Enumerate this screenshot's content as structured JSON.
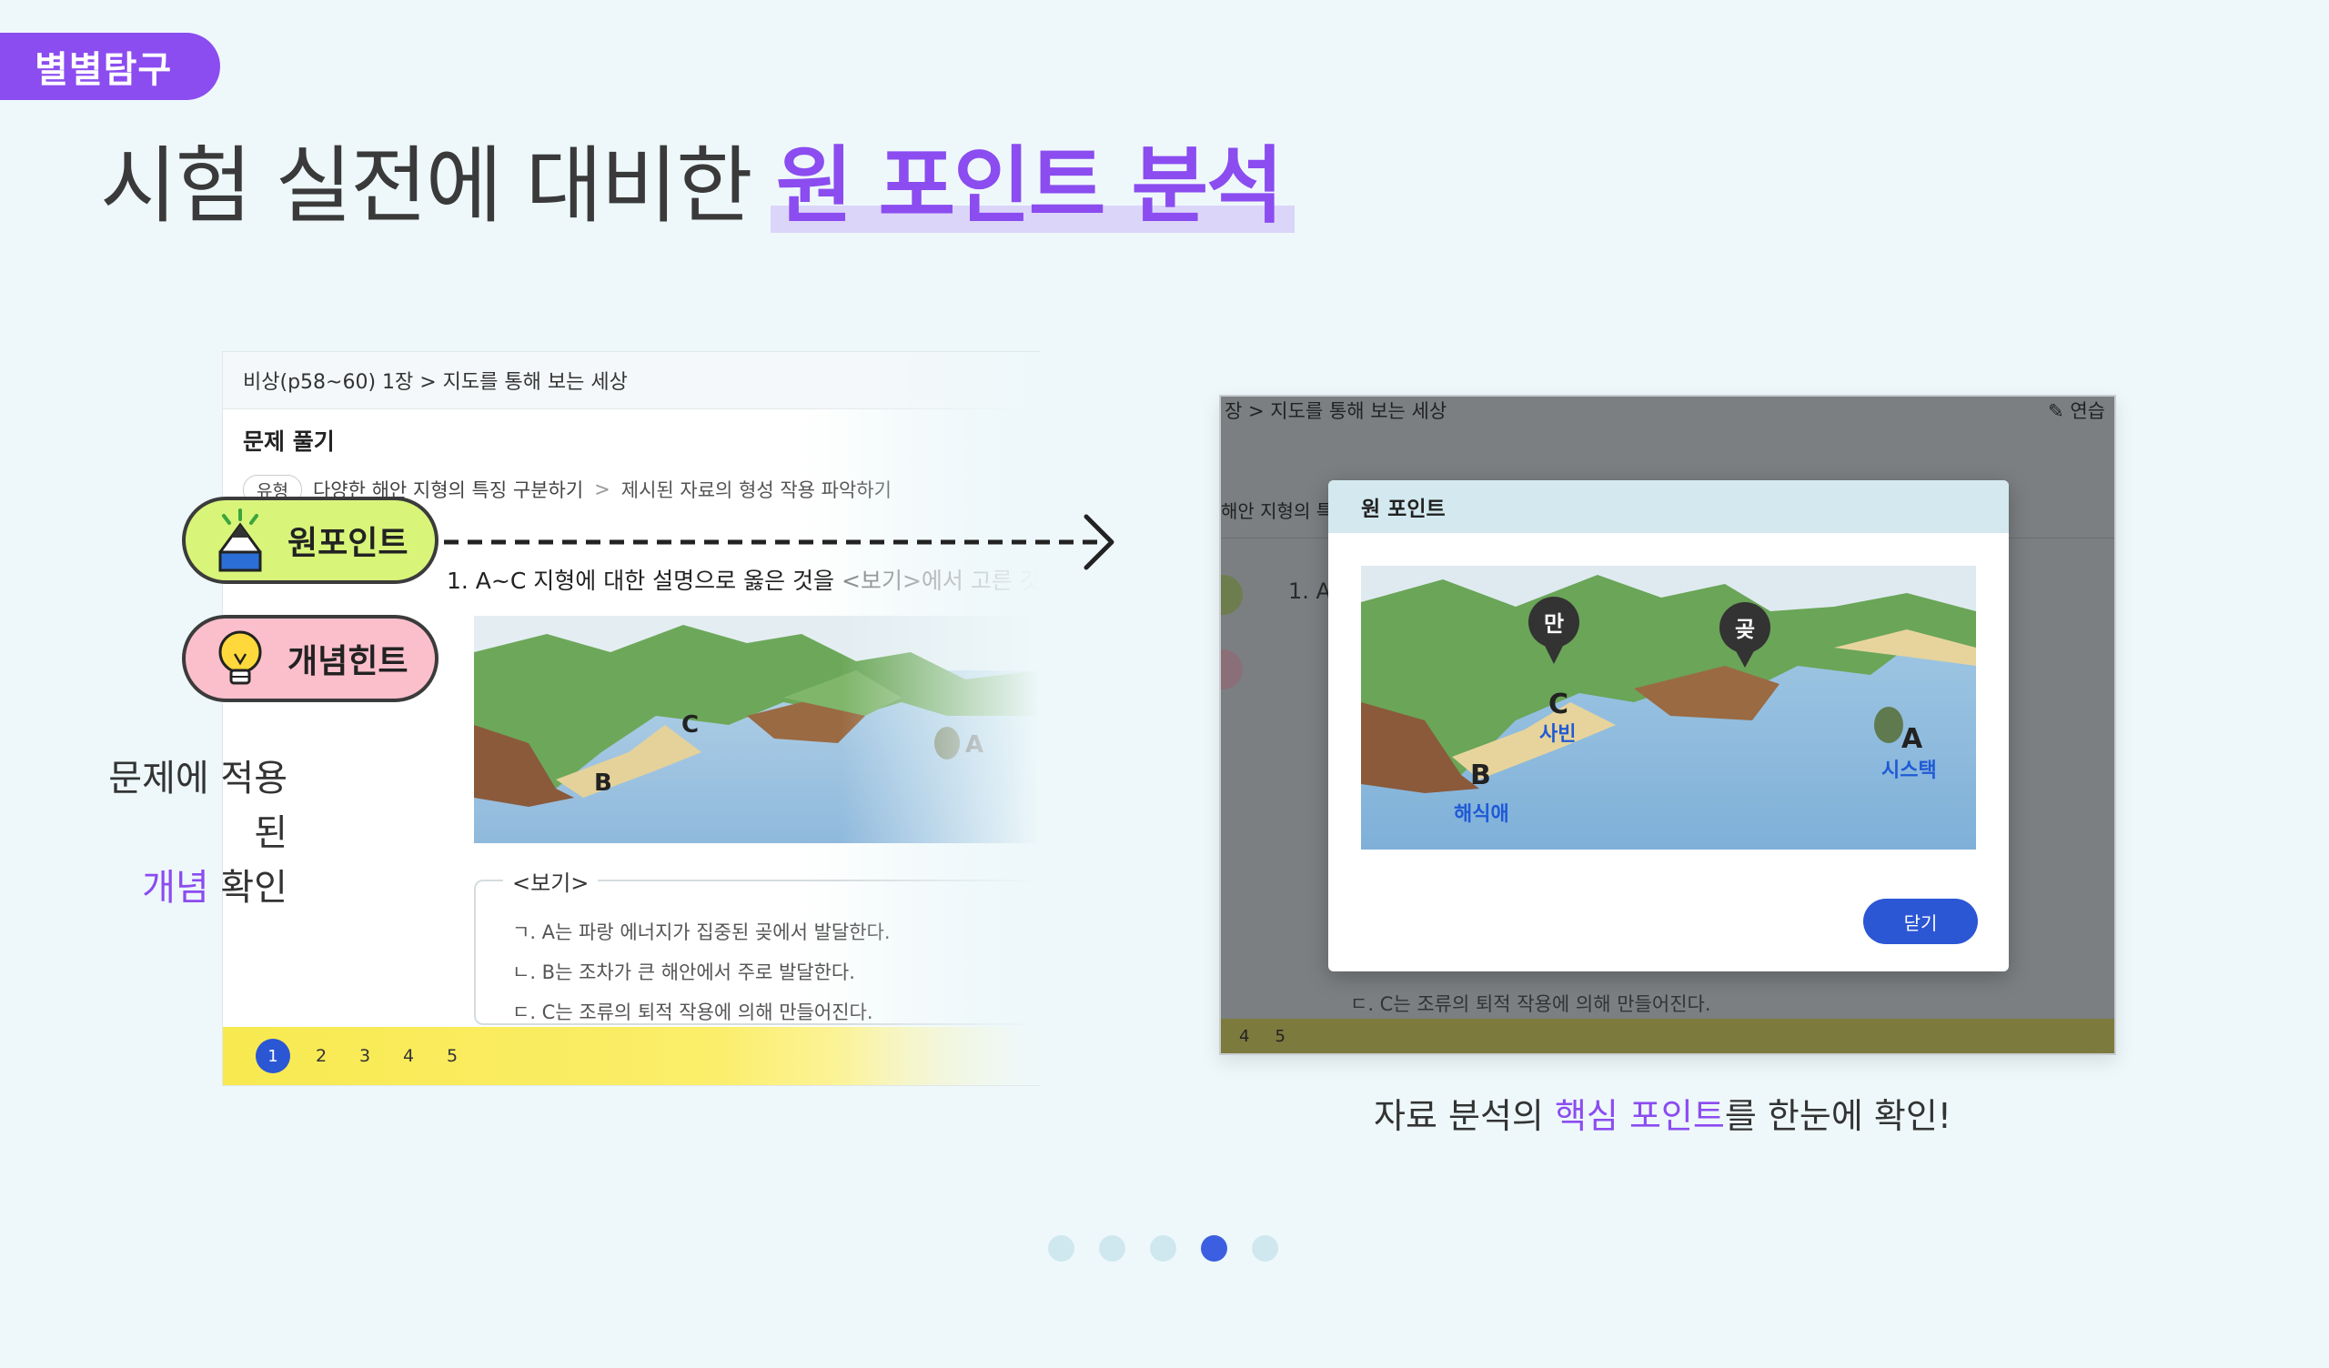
{
  "badge": "별별탐구",
  "headline": {
    "prefix": "시험 실전에 대비한 ",
    "highlight": "원 포인트 분석"
  },
  "left_panel": {
    "breadcrumb": "비상(p58~60) 1장 > 지도를 통해 보는 세상",
    "section_title": "문제 풀기",
    "type_tag": "유형",
    "crumb_a": "다양한 해안 지형의 특징 구분하기",
    "crumb_sep": ">",
    "crumb_b": "제시된 자료의 형성 작용 파악하기",
    "question": "1. A~C 지형에 대한 설명으로 옳은 것을",
    "question_muted": " <보기>에서 고른 것",
    "map_labels": [
      "B",
      "C",
      "A"
    ],
    "bogi_title": "<보기>",
    "bogi_items": [
      "ㄱ. A는 파랑 에너지가 집중된 곶에서 발달한다.",
      "ㄴ. B는 조차가 큰 해안에서 주로 발달한다.",
      "ㄷ. C는 조류의 퇴적 작용에 의해 만들어진다."
    ],
    "pages": [
      "1",
      "2",
      "3",
      "4",
      "5"
    ]
  },
  "pills": {
    "one_point": "원포인트",
    "concept_hint": "개념힌트"
  },
  "caption_left": {
    "line1": "문제에 적용된",
    "highlight": "개념",
    "rest": " 확인"
  },
  "right_panel": {
    "breadcrumb": "장 > 지도를 통해 보는 세상",
    "top_right": "연습",
    "crumb": "해안 지형의 특",
    "question": "1. A",
    "bottom_item": "ㄷ. C는 조류의 퇴적 작용에 의해 만들어진다.",
    "pages": [
      "4",
      "5"
    ]
  },
  "modal": {
    "title": "원 포인트",
    "pins": [
      "만",
      "곶"
    ],
    "letters": [
      "C",
      "B",
      "A"
    ],
    "labels": [
      "사빈",
      "해식애",
      "시스택"
    ],
    "close": "닫기"
  },
  "caption_right": {
    "prefix": "자료 분석의 ",
    "highlight": "핵심 포인트",
    "suffix": "를 한눈에 확인!"
  },
  "carousel": {
    "count": 5,
    "active_index": 3
  },
  "colors": {
    "accent": "#8b4cf0",
    "primary": "#2b56d4",
    "pill_green": "#d8f57a",
    "pill_pink": "#fbbfcc"
  }
}
